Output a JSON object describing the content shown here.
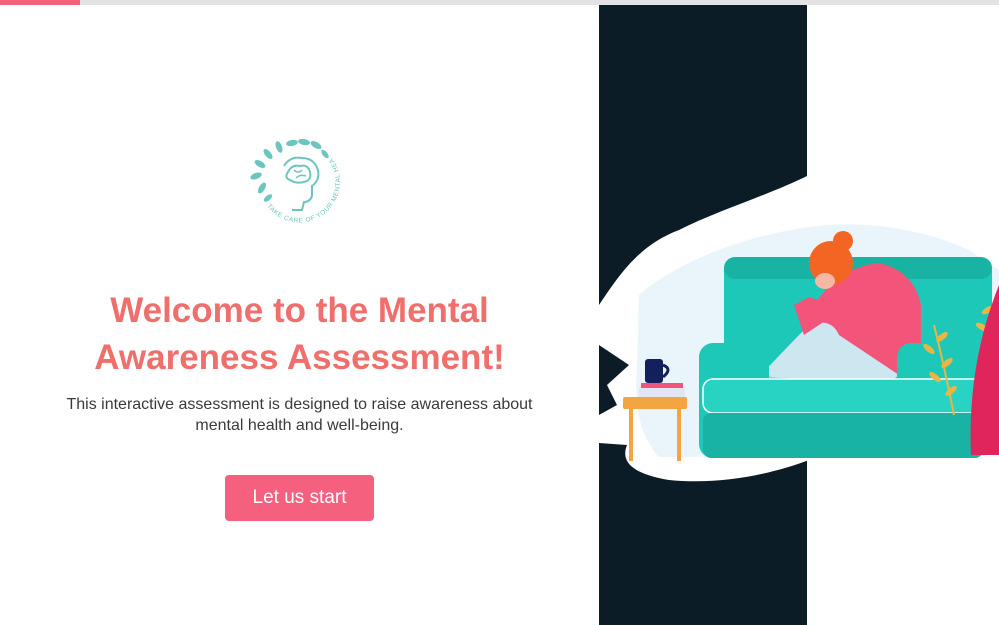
{
  "progress": {
    "percent": 8
  },
  "logo": {
    "text": "TAKE CARE OF YOUR MENTAL HEALTH",
    "icon": "brain-leaves-icon"
  },
  "welcome": {
    "title_line1": "Welcome to the Mental",
    "title_line2": "Awareness Assessment!",
    "subtitle": "This interactive assessment is designed to raise awareness about mental health and well-being."
  },
  "start_button": {
    "label": "Let us start"
  },
  "colors": {
    "accent": "#f5607e",
    "title": "#ef6f6c",
    "logo": "#6cc6bf",
    "dark_band": "#0b1c26",
    "sofa": "#1dc8b8"
  }
}
